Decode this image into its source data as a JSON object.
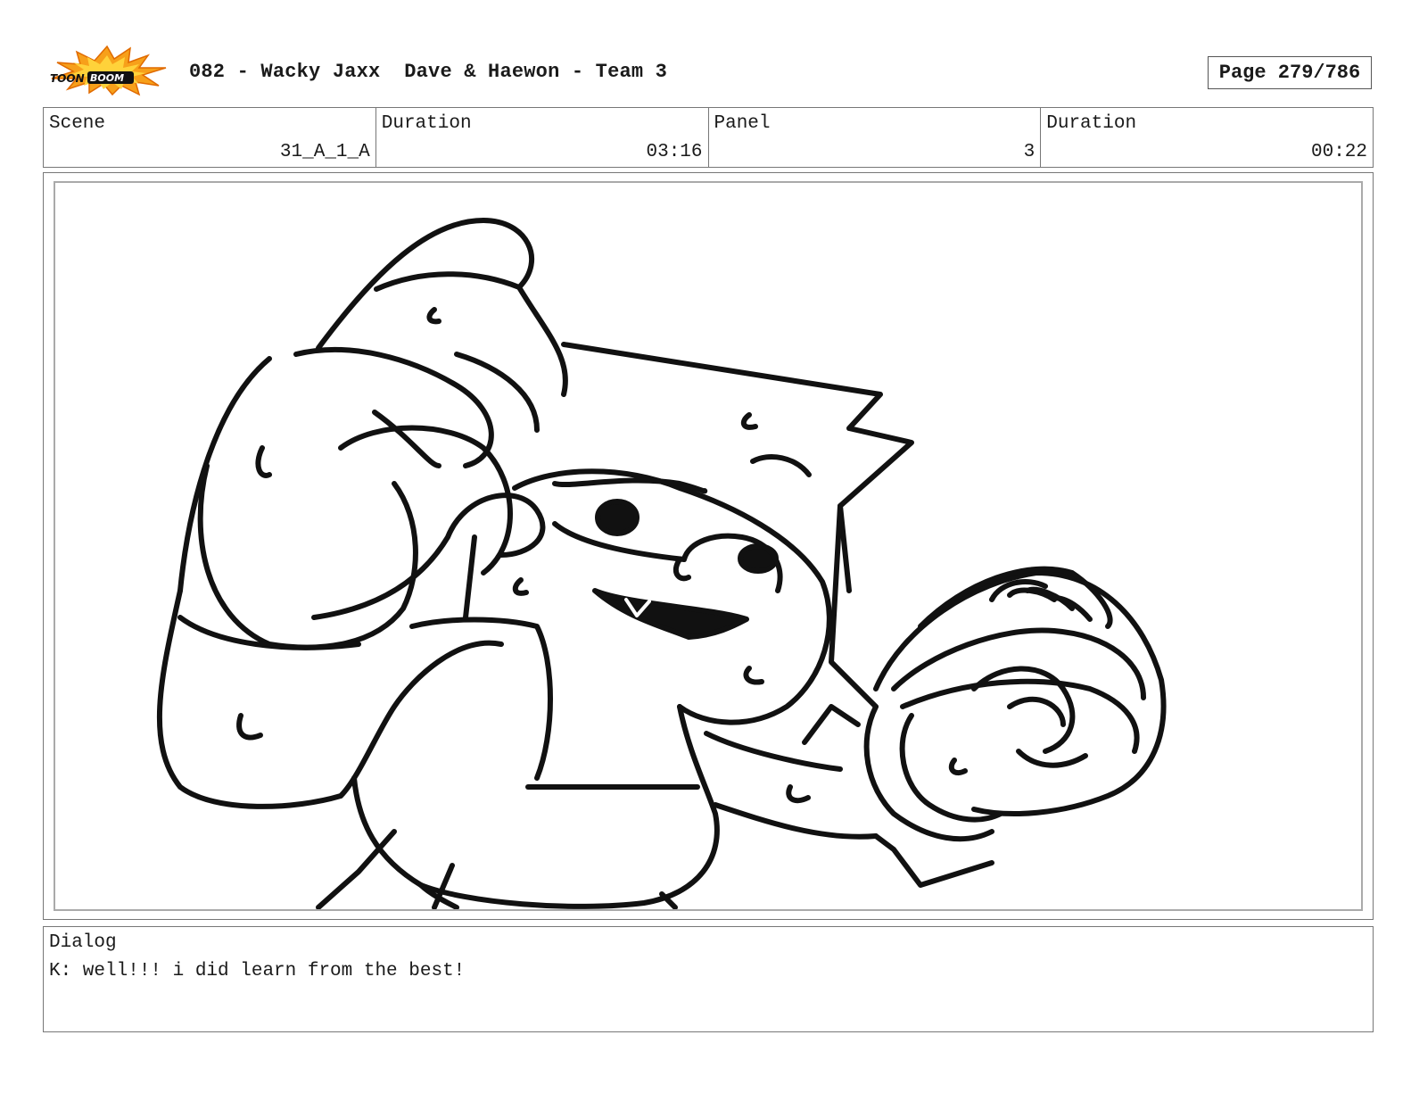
{
  "header": {
    "logo_text": "TOONBOOM",
    "title": "082 - Wacky Jaxx  Dave & Haewon - Team 3",
    "page": "Page 279/786"
  },
  "info": {
    "scene_label": "Scene",
    "scene_value": "31_A_1_A",
    "scene_duration_label": "Duration",
    "scene_duration_value": "03:16",
    "panel_label": "Panel",
    "panel_value": "3",
    "panel_duration_label": "Duration",
    "panel_duration_value": "00:22"
  },
  "dialog": {
    "label": "Dialog",
    "text": "K: well!!! i did learn from the best!"
  }
}
